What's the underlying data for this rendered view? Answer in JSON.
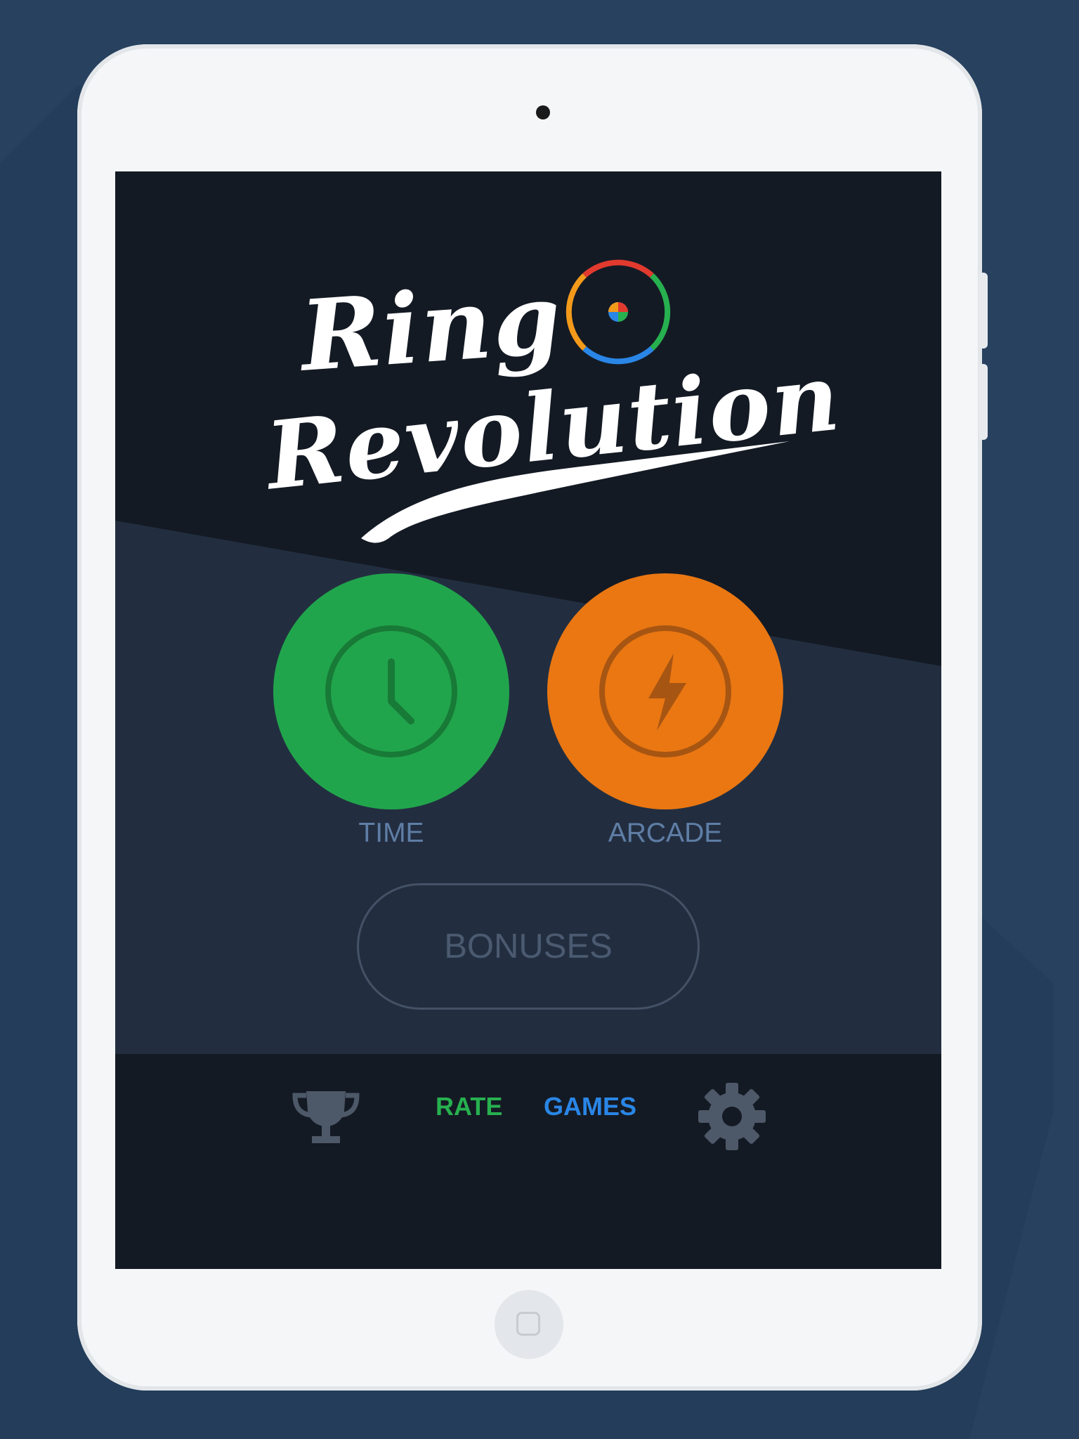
{
  "app": {
    "title_line1": "Ring",
    "title_line2": "Revolution",
    "logo_ring_colors": [
      "#e23a2f",
      "#27b04f",
      "#2a86e6",
      "#f39a1b"
    ]
  },
  "modes": [
    {
      "label": "TIME",
      "icon": "clock-icon",
      "color": "#21a54c"
    },
    {
      "label": "ARCADE",
      "icon": "lightning-icon",
      "color": "#ea7712"
    }
  ],
  "bonuses_label": "BONUSES",
  "bottom_bar": {
    "trophy_icon": "trophy-icon",
    "rate_label": "RATE",
    "games_label": "GAMES",
    "settings_icon": "gear-icon",
    "rate_color": "#27b04f",
    "games_color": "#2a86e6"
  }
}
